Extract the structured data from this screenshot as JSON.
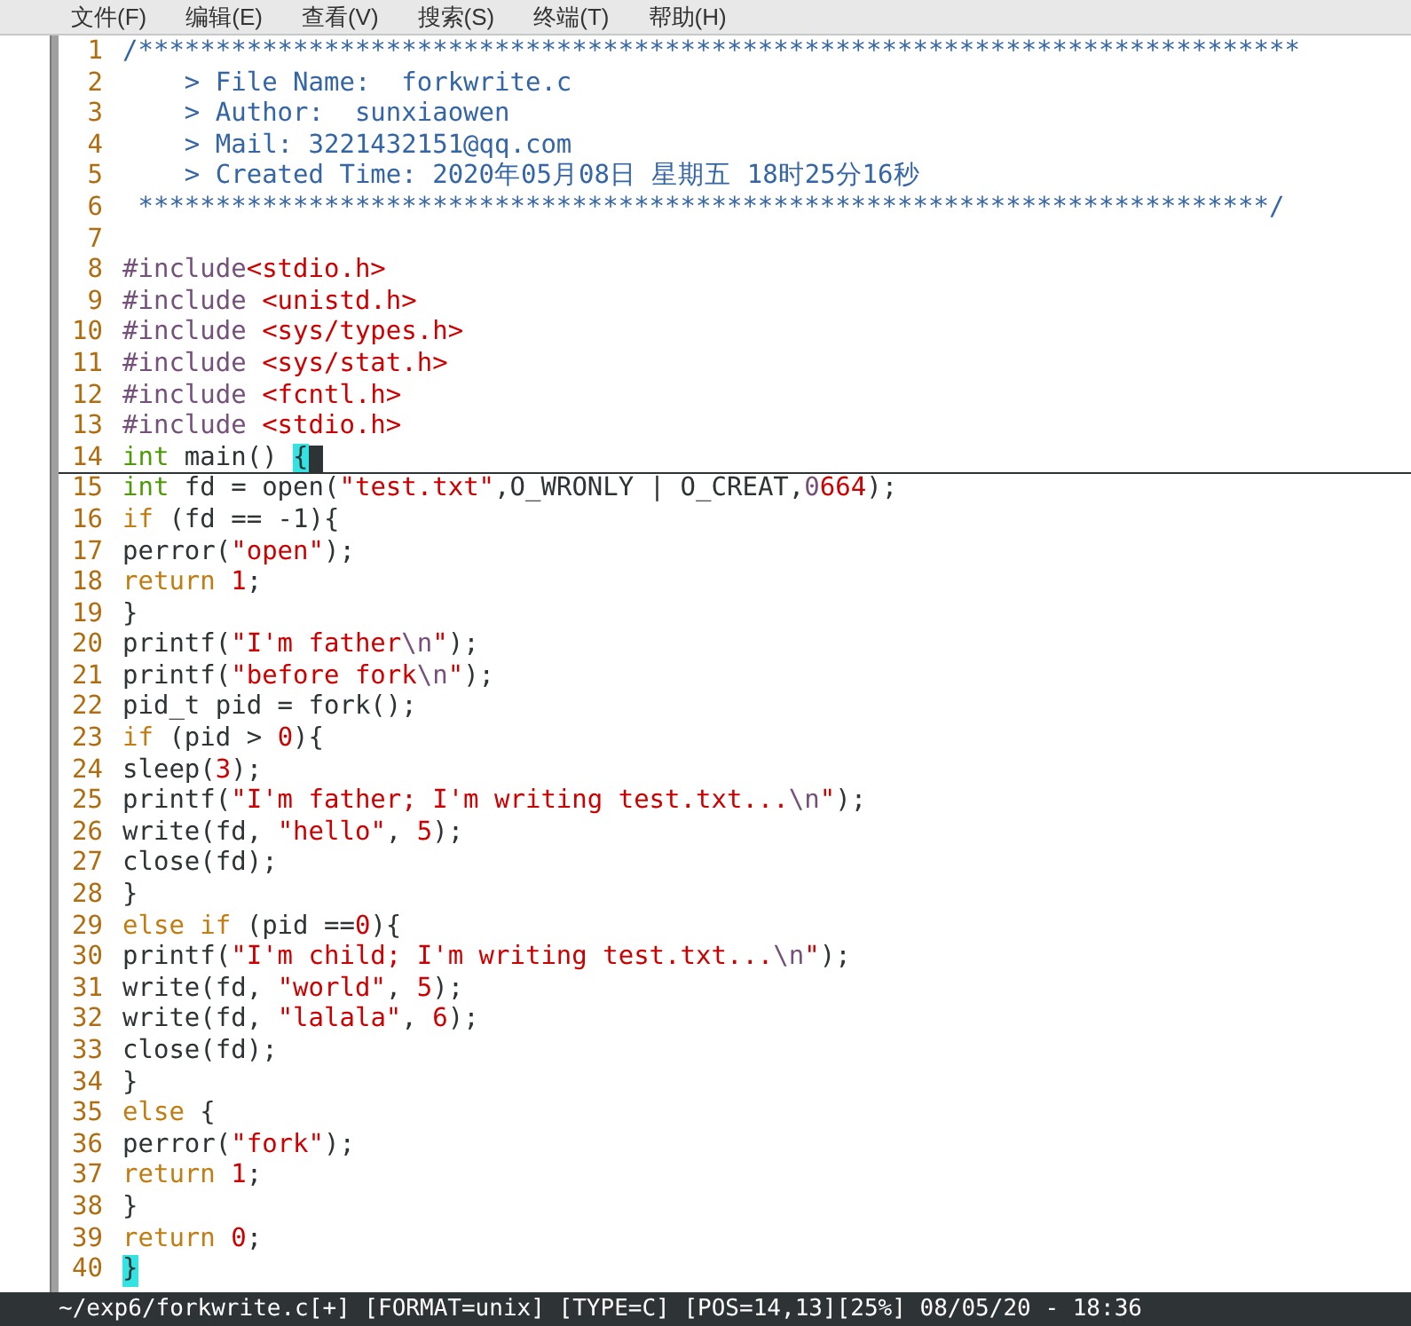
{
  "menu": [
    {
      "label": "文件(F)"
    },
    {
      "label": "编辑(E)"
    },
    {
      "label": "查看(V)"
    },
    {
      "label": "搜索(S)"
    },
    {
      "label": "终端(T)"
    },
    {
      "label": "帮助(H)"
    }
  ],
  "lines": [
    {
      "number": "1",
      "current": false,
      "tokens": [
        {
          "kind": "comment",
          "text": "/***************************************************************************"
        }
      ]
    },
    {
      "number": "2",
      "current": false,
      "tokens": [
        {
          "kind": "comment",
          "text": "    > File Name:  forkwrite.c"
        }
      ]
    },
    {
      "number": "3",
      "current": false,
      "tokens": [
        {
          "kind": "comment",
          "text": "    > Author:  sunxiaowen"
        }
      ]
    },
    {
      "number": "4",
      "current": false,
      "tokens": [
        {
          "kind": "comment",
          "text": "    > Mail: 3221432151@qq.com"
        }
      ]
    },
    {
      "number": "5",
      "current": false,
      "tokens": [
        {
          "kind": "comment",
          "text": "    > Created Time: 2020年05月08日 星期五 18时25分16秒"
        }
      ]
    },
    {
      "number": "6",
      "current": false,
      "tokens": [
        {
          "kind": "comment",
          "text": " *************************************************************************/"
        }
      ]
    },
    {
      "number": "7",
      "current": false
    },
    {
      "number": "8",
      "current": false,
      "tokens": [
        {
          "kind": "preproc",
          "text": "#include"
        },
        {
          "kind": "string",
          "text": "<stdio.h>"
        }
      ]
    },
    {
      "number": "9",
      "current": false,
      "tokens": [
        {
          "kind": "preproc",
          "text": "#include "
        },
        {
          "kind": "string",
          "text": "<unistd.h>"
        }
      ]
    },
    {
      "number": "10",
      "current": false,
      "tokens": [
        {
          "kind": "preproc",
          "text": "#include "
        },
        {
          "kind": "string",
          "text": "<sys/types.h>"
        }
      ]
    },
    {
      "number": "11",
      "current": false,
      "tokens": [
        {
          "kind": "preproc",
          "text": "#include "
        },
        {
          "kind": "string",
          "text": "<sys/stat.h>"
        }
      ]
    },
    {
      "number": "12",
      "current": false,
      "tokens": [
        {
          "kind": "preproc",
          "text": "#include "
        },
        {
          "kind": "string",
          "text": "<fcntl.h>"
        }
      ]
    },
    {
      "number": "13",
      "current": false,
      "tokens": [
        {
          "kind": "preproc",
          "text": "#include "
        },
        {
          "kind": "string",
          "text": "<stdio.h>"
        }
      ]
    },
    {
      "number": "14",
      "current": true,
      "tokens": [
        {
          "kind": "type",
          "text": "int"
        },
        {
          "kind": "plain",
          "text": " main() "
        },
        {
          "kind": "match",
          "text": "{"
        }
      ]
    },
    {
      "number": "15",
      "current": false,
      "tokens": [
        {
          "kind": "type",
          "text": "int"
        },
        {
          "kind": "plain",
          "text": " fd = open("
        },
        {
          "kind": "string",
          "text": "\"test.txt\""
        },
        {
          "kind": "plain",
          "text": ",O_WRONLY | O_CREAT,"
        },
        {
          "kind": "octal",
          "text": "0"
        },
        {
          "kind": "number",
          "text": "664"
        },
        {
          "kind": "plain",
          "text": ");"
        }
      ]
    },
    {
      "number": "16",
      "current": false,
      "tokens": [
        {
          "kind": "keyword",
          "text": "if"
        },
        {
          "kind": "plain",
          "text": " (fd == -1){"
        }
      ]
    },
    {
      "number": "17",
      "current": false,
      "tokens": [
        {
          "kind": "plain",
          "text": "perror("
        },
        {
          "kind": "string",
          "text": "\"open\""
        },
        {
          "kind": "plain",
          "text": ");"
        }
      ]
    },
    {
      "number": "18",
      "current": false,
      "tokens": [
        {
          "kind": "keyword",
          "text": "return "
        },
        {
          "kind": "number",
          "text": "1"
        },
        {
          "kind": "plain",
          "text": ";"
        }
      ]
    },
    {
      "number": "19",
      "current": false,
      "tokens": [
        {
          "kind": "plain",
          "text": "}"
        }
      ]
    },
    {
      "number": "20",
      "current": false,
      "tokens": [
        {
          "kind": "plain",
          "text": "printf("
        },
        {
          "kind": "string",
          "text": "\"I'm father"
        },
        {
          "kind": "escape",
          "text": "\\n"
        },
        {
          "kind": "string",
          "text": "\""
        },
        {
          "kind": "plain",
          "text": ");"
        }
      ]
    },
    {
      "number": "21",
      "current": false,
      "tokens": [
        {
          "kind": "plain",
          "text": "printf("
        },
        {
          "kind": "string",
          "text": "\"before fork"
        },
        {
          "kind": "escape",
          "text": "\\n"
        },
        {
          "kind": "string",
          "text": "\""
        },
        {
          "kind": "plain",
          "text": ");"
        }
      ]
    },
    {
      "number": "22",
      "current": false,
      "tokens": [
        {
          "kind": "plain",
          "text": "pid_t pid = fork();"
        }
      ]
    },
    {
      "number": "23",
      "current": false,
      "tokens": [
        {
          "kind": "keyword",
          "text": "if"
        },
        {
          "kind": "plain",
          "text": " (pid > "
        },
        {
          "kind": "number",
          "text": "0"
        },
        {
          "kind": "plain",
          "text": "){"
        }
      ]
    },
    {
      "number": "24",
      "current": false,
      "tokens": [
        {
          "kind": "plain",
          "text": "sleep("
        },
        {
          "kind": "number",
          "text": "3"
        },
        {
          "kind": "plain",
          "text": ");"
        }
      ]
    },
    {
      "number": "25",
      "current": false,
      "tokens": [
        {
          "kind": "plain",
          "text": "printf("
        },
        {
          "kind": "string",
          "text": "\"I'm father; I'm writing test.txt..."
        },
        {
          "kind": "escape",
          "text": "\\n"
        },
        {
          "kind": "string",
          "text": "\""
        },
        {
          "kind": "plain",
          "text": ");"
        }
      ]
    },
    {
      "number": "26",
      "current": false,
      "tokens": [
        {
          "kind": "plain",
          "text": "write(fd, "
        },
        {
          "kind": "string",
          "text": "\"hello\""
        },
        {
          "kind": "plain",
          "text": ", "
        },
        {
          "kind": "number",
          "text": "5"
        },
        {
          "kind": "plain",
          "text": ");"
        }
      ]
    },
    {
      "number": "27",
      "current": false,
      "tokens": [
        {
          "kind": "plain",
          "text": "close(fd);"
        }
      ]
    },
    {
      "number": "28",
      "current": false,
      "tokens": [
        {
          "kind": "plain",
          "text": "}"
        }
      ]
    },
    {
      "number": "29",
      "current": false,
      "tokens": [
        {
          "kind": "keyword",
          "text": "else if"
        },
        {
          "kind": "plain",
          "text": " (pid =="
        },
        {
          "kind": "number",
          "text": "0"
        },
        {
          "kind": "plain",
          "text": "){"
        }
      ]
    },
    {
      "number": "30",
      "current": false,
      "tokens": [
        {
          "kind": "plain",
          "text": "printf("
        },
        {
          "kind": "string",
          "text": "\"I'm child; I'm writing test.txt..."
        },
        {
          "kind": "escape",
          "text": "\\n"
        },
        {
          "kind": "string",
          "text": "\""
        },
        {
          "kind": "plain",
          "text": ");"
        }
      ]
    },
    {
      "number": "31",
      "current": false,
      "tokens": [
        {
          "kind": "plain",
          "text": "write(fd, "
        },
        {
          "kind": "string",
          "text": "\"world\""
        },
        {
          "kind": "plain",
          "text": ", "
        },
        {
          "kind": "number",
          "text": "5"
        },
        {
          "kind": "plain",
          "text": ");"
        }
      ]
    },
    {
      "number": "32",
      "current": false,
      "tokens": [
        {
          "kind": "plain",
          "text": "write(fd, "
        },
        {
          "kind": "string",
          "text": "\"lalala\""
        },
        {
          "kind": "plain",
          "text": ", "
        },
        {
          "kind": "number",
          "text": "6"
        },
        {
          "kind": "plain",
          "text": ");"
        }
      ]
    },
    {
      "number": "33",
      "current": false,
      "tokens": [
        {
          "kind": "plain",
          "text": "close(fd);"
        }
      ]
    },
    {
      "number": "34",
      "current": false,
      "tokens": [
        {
          "kind": "plain",
          "text": "}"
        }
      ]
    },
    {
      "number": "35",
      "current": false,
      "tokens": [
        {
          "kind": "keyword",
          "text": "else"
        },
        {
          "kind": "plain",
          "text": " {"
        }
      ]
    },
    {
      "number": "36",
      "current": false,
      "tokens": [
        {
          "kind": "plain",
          "text": "perror("
        },
        {
          "kind": "string",
          "text": "\"fork\""
        },
        {
          "kind": "plain",
          "text": ");"
        }
      ]
    },
    {
      "number": "37",
      "current": false,
      "tokens": [
        {
          "kind": "keyword",
          "text": "return "
        },
        {
          "kind": "number",
          "text": "1"
        },
        {
          "kind": "plain",
          "text": ";"
        }
      ]
    },
    {
      "number": "38",
      "current": false,
      "tokens": [
        {
          "kind": "plain",
          "text": "}"
        }
      ]
    },
    {
      "number": "39",
      "current": false,
      "tokens": [
        {
          "kind": "keyword",
          "text": "return "
        },
        {
          "kind": "number",
          "text": "0"
        },
        {
          "kind": "plain",
          "text": ";"
        }
      ]
    },
    {
      "number": "40",
      "current": false,
      "tokens": [
        {
          "kind": "match",
          "text": "}"
        }
      ]
    }
  ],
  "status_bar": "~/exp6/forkwrite.c[+] [FORMAT=unix] [TYPE=C] [POS=14,13][25%] 08/05/20 - 18:36"
}
